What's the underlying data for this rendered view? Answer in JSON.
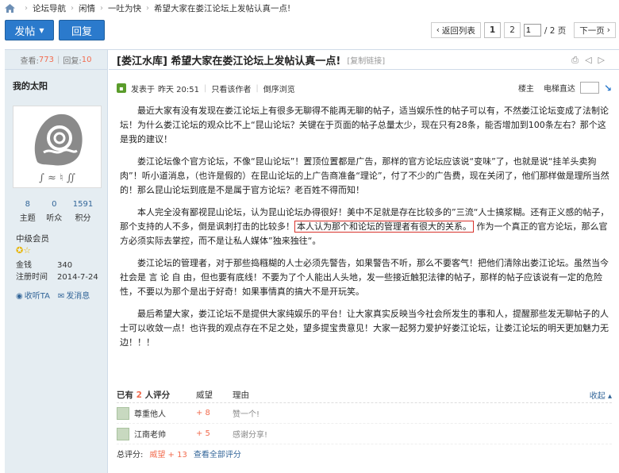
{
  "breadcrumb": [
    "论坛导航",
    "闲情",
    "一吐为快",
    "希望大家在娄江论坛上发帖认真一点!"
  ],
  "toolbar": {
    "post_label": "发帖",
    "reply_label": "回复",
    "back_label": "返回列表",
    "pages": [
      "1",
      "2"
    ],
    "page_input": "1",
    "page_total": "/ 2 页",
    "next_label": "下一页"
  },
  "sidebar": {
    "views_label": "查看:",
    "views": "773",
    "replies_label": "回复:",
    "replies": "10",
    "author": "我的太阳",
    "counts": [
      {
        "value": "8",
        "label": "主题"
      },
      {
        "value": "0",
        "label": "听众"
      },
      {
        "value": "1591",
        "label": "积分"
      }
    ],
    "group": "中级会员",
    "money_label": "金钱",
    "money": "340",
    "reg_label": "注册时间",
    "reg": "2014-7-24",
    "collect_label": "收听TA",
    "message_label": "发消息"
  },
  "post": {
    "title": "[娄江水库] 希望大家在娄江论坛上发帖认真一点!",
    "copy_link": "[复制链接]",
    "posted_label": "发表于",
    "posted_time": "昨天 20:51",
    "author_only": "只看该作者",
    "reverse": "倒序浏览",
    "floor_label": "楼主",
    "jump_label": "电梯直达",
    "paragraphs": [
      "最近大家有没有发现在娄江论坛上有很多无聊得不能再无聊的帖子，适当娱乐性的帖子可以有，不然娄江论坛变成了法制论坛！为什么娄江论坛的观众比不上“昆山论坛？关键在于页面的帖子总量太少，现在只有28条，能否增加到100条左右？那个这是我的建议！",
      "娄江论坛像个官方论坛，不像“昆山论坛”！置顶位置都是广告，那样的官方论坛应该说“变味”了，也就是说“挂羊头卖狗肉”！听小道消息，（也许是假的）在昆山论坛的上广告商准备“理论”，付了不少的广告费，现在关闭了，他们那样做是理所当然的！那么昆山论坛到底是不是属于官方论坛？老百姓不得而知！",
      "本人完全没有鄙视昆山论坛，认为昆山论坛办得很好！美中不足就是存在比较多的”三流“人士搞浆糊。还有正义感的帖子，那个支持的人不多，倒是讽刺打击的比较多！",
      "娄江论坛的管理者，对于那些捣糨糊的人士必须先警告，如果警告不听，那么不要客气！把他们清除出娄江论坛。虽然当今社会是 言 论 自 由，但也要有底线！不要为了个人能出人头地，发一些接近触犯法律的帖子，那样的帖子应该说有一定的危险性，不要以为那个是出于好奇！如果事情真的搞大不是开玩笑。",
      "最后希望大家，娄江论坛不是提供大家纯娱乐的平台！让大家真实反映当今社会所发生的事和人，提醒那些发无聊帖子的人士可以收敛一点！也许我的观点存在不足之处，望多提宝贵意见！大家一起努力爱护好娄江论坛，让娄江论坛的明天更加魅力无边！！！"
    ],
    "boxed_text": "本人认为那个和论坛的管理者有很大的关系。",
    "after_boxed": "作为一个真正的官方论坛，那么官方必须实际去掌控，而不是让私人媒体”独来独往“。"
  },
  "rating": {
    "prefix": "已有",
    "count": "2",
    "suffix": "人评分",
    "col_prestige": "威望",
    "col_reason": "理由",
    "collapse": "收起",
    "rows": [
      {
        "user": "尊重他人",
        "score": "+ 8",
        "reason": "赞一个!"
      },
      {
        "user": "江南老帅",
        "score": "+ 5",
        "reason": "感谢分享!"
      }
    ],
    "total_label": "总评分:",
    "total": "威望 + 13",
    "view_all": "查看全部评分"
  },
  "colors": {
    "accent": "#2b7acc",
    "highlight": "#f26c4f",
    "sidebar_bg": "#e5edf2"
  }
}
